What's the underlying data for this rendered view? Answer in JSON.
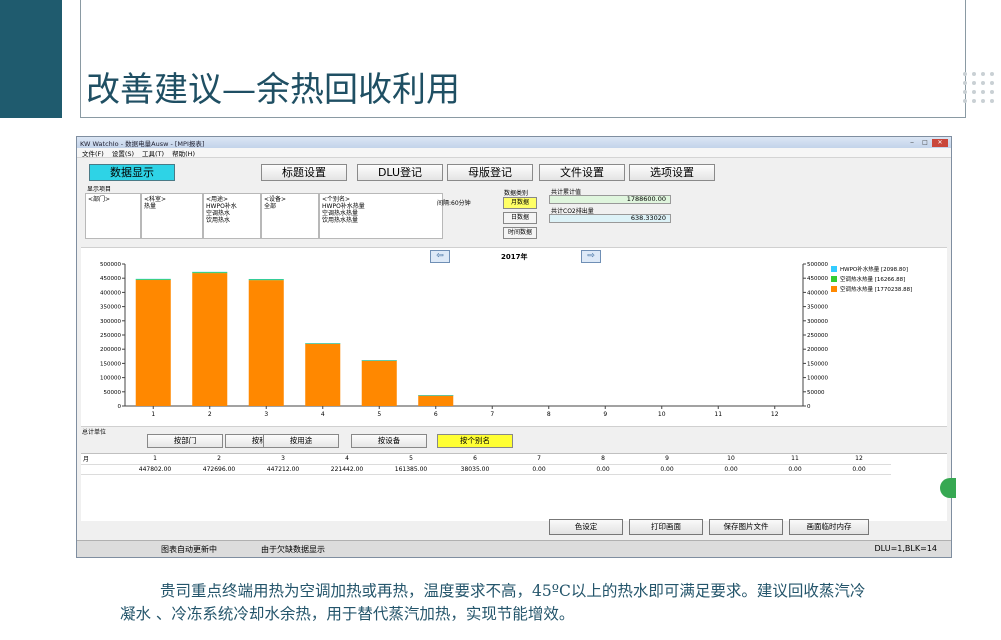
{
  "slide": {
    "title": "改善建议—余热回收利用"
  },
  "window": {
    "title": "KW WatchIo - 数据电量Ausw - [MPI报表]",
    "menu": [
      "文件(F)",
      "设置(S)",
      "工具(T)",
      "帮助(H)"
    ]
  },
  "toolbar": {
    "items": [
      "数据显示",
      "标题设置",
      "DLU登记",
      "母版登记",
      "文件设置",
      "选项设置"
    ]
  },
  "filters": {
    "section_label": "显示项目",
    "columns": [
      {
        "header": "<部门>",
        "values": []
      },
      {
        "header": "<科室>",
        "values": [
          "热量"
        ]
      },
      {
        "header": "<用途>",
        "values": [
          "HWPO补水",
          "空调热水",
          "饮用热水"
        ]
      },
      {
        "header": "<设备>",
        "values": [
          "全部"
        ]
      },
      {
        "header": "<个别名>",
        "values": [
          "HWPO补水热量",
          "空调热水热量",
          "饮用热水热量"
        ]
      }
    ],
    "period": "间隔:60分钟"
  },
  "data_type": {
    "label": "数据类别",
    "buttons": [
      "月数据",
      "日数据",
      "时间数据"
    ]
  },
  "totals": {
    "total_label": "共计累计值",
    "total_value": "1788600.00",
    "co2_label": "共计CO2排出量",
    "co2_value": "638.33020"
  },
  "chart_header": {
    "year": "2017年",
    "prev_arrow": "⇦",
    "next_arrow": "⇨"
  },
  "chart_data": {
    "type": "bar",
    "stacked": true,
    "categories": [
      "1",
      "2",
      "3",
      "4",
      "5",
      "6",
      "7",
      "8",
      "9",
      "10",
      "11",
      "12"
    ],
    "series": [
      {
        "name": "HWPO补水热量 [2098.80]",
        "color": "#33ccff",
        "values": [
          1200,
          1300,
          1200,
          600,
          400,
          98,
          0,
          0,
          0,
          0,
          0,
          0
        ]
      },
      {
        "name": "空调热水热量 [16266.88]",
        "color": "#33cc33",
        "values": [
          3000,
          3200,
          3000,
          1500,
          1000,
          266,
          0,
          0,
          0,
          0,
          0,
          0
        ]
      },
      {
        "name": "空调热水热量 [1770238.88]",
        "color": "#ff8800",
        "values": [
          443602,
          467996,
          443012,
          219342,
          159985,
          37671,
          0,
          0,
          0,
          0,
          0,
          0
        ]
      }
    ],
    "ylim": [
      0,
      500000
    ],
    "yticks": [
      "500000",
      "450000",
      "400000",
      "350000",
      "300000",
      "250000",
      "200000",
      "150000",
      "100000",
      "50000",
      "0"
    ],
    "legend_position": "right",
    "grid": false
  },
  "grouping": {
    "label": "总计单位",
    "buttons": [
      "按部门",
      "按科室",
      "按用途",
      "按设备",
      "按个别名"
    ]
  },
  "table": {
    "header_label": "月",
    "months": [
      "1",
      "2",
      "3",
      "4",
      "5",
      "6",
      "7",
      "8",
      "9",
      "10",
      "11",
      "12"
    ],
    "values": [
      "447802.00",
      "472696.00",
      "447212.00",
      "221442.00",
      "161385.00",
      "38035.00",
      "0.00",
      "0.00",
      "0.00",
      "0.00",
      "0.00",
      "0.00"
    ]
  },
  "bottom_buttons": [
    "色设定",
    "打印画面",
    "保存图片文件",
    "画面临时内存"
  ],
  "status": {
    "left1": "图表自动更新中",
    "left2": "由于欠缺数据显示",
    "right": "DLU=1,BLK=14"
  },
  "note": {
    "text": "贵司重点终端用热为空调加热或再热，温度要求不高，45ºC以上的热水即可满足要求。建议回收蒸汽冷凝水 、冷冻系统冷却水余热，用于替代蒸汽加热，实现节能增效。"
  }
}
